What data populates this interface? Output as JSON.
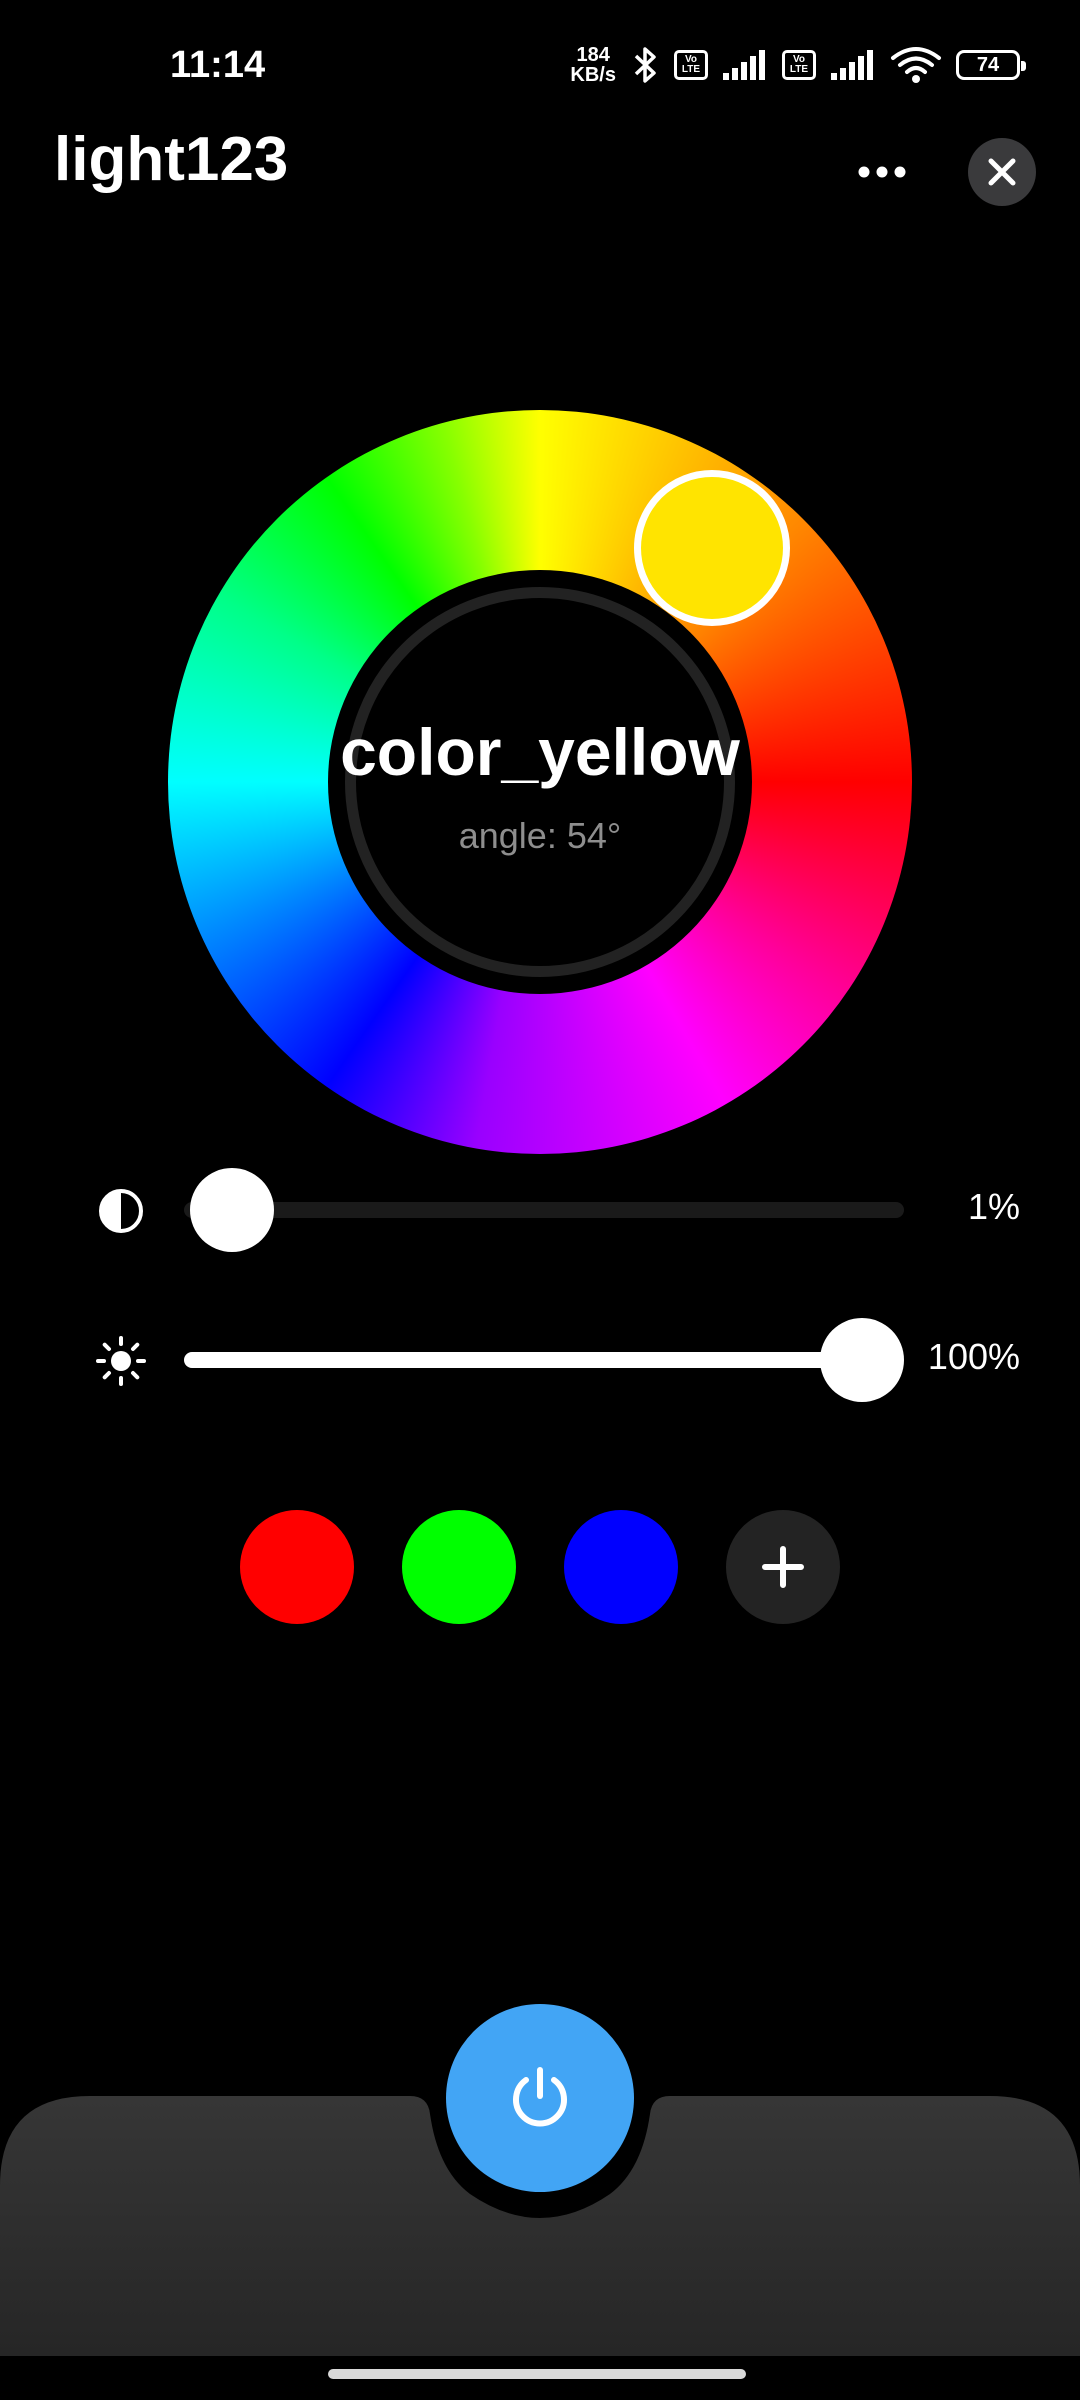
{
  "status_bar": {
    "time": "11:14",
    "net_speed_value": "184",
    "net_speed_unit": "KB/s",
    "volte_label_top": "Vo",
    "volte_label_bottom": "LTE",
    "battery": "74",
    "icons": [
      "bluetooth-icon",
      "volte-icon",
      "signal-icon",
      "volte-icon",
      "signal-icon",
      "wifi-icon",
      "battery-icon"
    ]
  },
  "header": {
    "title": "light123",
    "more_icon": "more-icon",
    "close_icon": "close-icon"
  },
  "color_wheel": {
    "color_name": "color_yellow",
    "angle_text": "angle: 54°",
    "selected_color": "#ffe400"
  },
  "sliders": {
    "saturation": {
      "icon": "contrast-icon",
      "value_text": "1%",
      "level": 0.01
    },
    "brightness": {
      "icon": "sun-icon",
      "value_text": "100%",
      "level": 1.0
    }
  },
  "presets": [
    {
      "color": "#ff0000"
    },
    {
      "color": "#00ff00"
    },
    {
      "color": "#0000ff"
    }
  ],
  "add_preset_icon": "plus-icon",
  "power_icon": "power-icon",
  "colors": {
    "accent": "#42a5f5",
    "background": "#000000",
    "panel": "#2a2a2a"
  }
}
